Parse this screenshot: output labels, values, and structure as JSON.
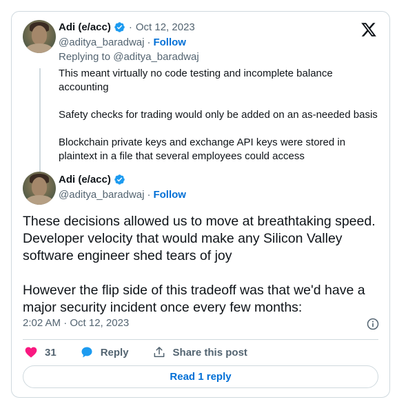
{
  "tweet_parent": {
    "author_name": "Adi (e/acc)",
    "date": "Oct 12, 2023",
    "handle": "@aditya_baradwaj",
    "follow_label": "Follow",
    "replying_to": "Replying to @aditya_baradwaj",
    "paragraphs": [
      "This meant virtually no code testing and incomplete balance accounting",
      "Safety checks for trading would only be added on an as-needed basis",
      "Blockchain private keys and exchange API keys were stored in plaintext in a file that several employees could access"
    ]
  },
  "tweet_main": {
    "author_name": "Adi (e/acc)",
    "handle": "@aditya_baradwaj",
    "follow_label": "Follow",
    "paragraphs": [
      "These decisions allowed us to move at breathtaking speed. Developer velocity that would make any Silicon Valley software engineer shed tears of joy",
      "However the flip side of this tradeoff was that we'd have a major security incident once every few months:"
    ],
    "timestamp": "2:02 AM · Oct 12, 2023"
  },
  "actions": {
    "like_count": "31",
    "reply_label": "Reply",
    "share_label": "Share this post"
  },
  "read_reply_label": "Read 1 reply",
  "colors": {
    "accent": "#006fd6",
    "verified": "#1d9bf0",
    "like": "#f91880",
    "muted_text": "#536471",
    "border": "#cfd9de"
  },
  "icons": [
    "x-logo-icon",
    "verified-badge-icon",
    "info-icon",
    "heart-icon",
    "reply-bubble-icon",
    "share-icon"
  ]
}
